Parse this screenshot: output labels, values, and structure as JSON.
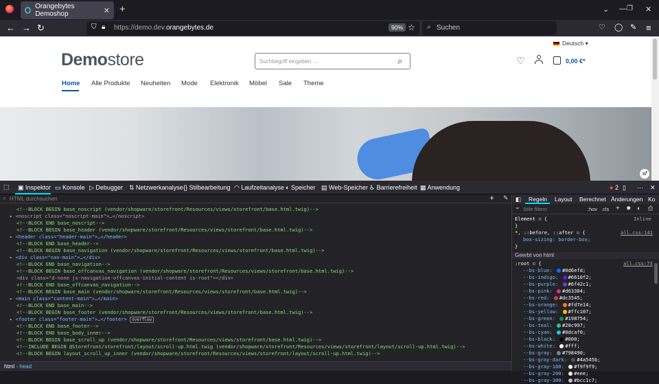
{
  "browser": {
    "tab_title": "Orangebytes Demoshop",
    "url_prefix": "https://demo.dev.",
    "url_domain": "orangebytes.de",
    "zoom": "90%",
    "search_placeholder": "Suchen"
  },
  "site": {
    "logo_bold": "Demo",
    "logo_light": "store",
    "search_placeholder": "Suchbegriff eingeben ...",
    "language": "Deutsch",
    "cart_total": "0,00 €*",
    "menu": [
      "Home",
      "Alle Produkte",
      "Neuheiten",
      "Mode",
      "Elektronik",
      "Möbel",
      "Sale",
      "Theme"
    ]
  },
  "devtools": {
    "tabs": [
      "Inspektor",
      "Konsole",
      "Debugger",
      "Netzwerkanalyse",
      "Stilbearbeitung",
      "Laufzeitanalyse",
      "Speicher",
      "Web-Speicher",
      "Barrierefreiheit",
      "Anwendung"
    ],
    "error_count": "2",
    "html_search_placeholder": "HTML durchsuchen",
    "breadcrumb": [
      "html",
      "head"
    ],
    "markup_lines": [
      "<!--BLOCK BEGIN base_noscript (vendor/shopware/storefront/Resources/views/storefront/base.html.twig)-->",
      "<noscript class=\"noscript-main\">…</noscript>",
      "<!--BLOCK END base_noscript-->",
      "<!--BLOCK BEGIN base_header (vendor/shopware/storefront/Resources/views/storefront/base.html.twig)-->",
      "<header class=\"header-main\">…</header>",
      "<!--BLOCK END base_header-->",
      "<!--BLOCK BEGIN base_navigation (vendor/shopware/storefront/Resources/views/storefront/base.html.twig)-->",
      "<div class=\"nav-main\">…</div>",
      "<!--BLOCK END base_navigation-->",
      "<!--BLOCK BEGIN base_offcanvas_navigation (vendor/shopware/storefront/Resources/views/storefront/base.html.twig)-->",
      "<div class=\"d-none js-navigation-offcanvas-initial-content is-root\"></div>",
      "<!--BLOCK END base_offcanvas_navigation-->",
      "<!--BLOCK BEGIN base_main (vendor/shopware/storefront/Resources/views/storefront/base.html.twig)-->",
      "<main class=\"content-main\">…</main>",
      "<!--BLOCK END base_main-->",
      "<!--BLOCK BEGIN base_footer (vendor/shopware/storefront/Resources/views/storefront/base.html.twig)-->",
      "<footer class=\"footer-main\">…</footer>",
      "<!--BLOCK END base_footer-->",
      "<!--BLOCK END base_body_inner-->",
      "<!--BLOCK BEGIN base_scroll_up (vendor/shopware/storefront/Resources/views/storefront/base.html.twig)-->",
      "<!--INCLUDE BEGIN @Storefront/storefront/layout/scroll-up.html.twig (vendor/shopware/storefront/Resources/views/storefront/layout/scroll-up.html.twig)-->",
      "<!--BLOCK BEGIN layout_scroll_up_inner (vendor/shopware/storefront/Resources/views/storefront/layout/scroll-up.html.twig)-->"
    ],
    "overflow_badge": "overflow",
    "rules_tabs": [
      "Regeln",
      "Layout",
      "Berechnet",
      "Änderungen",
      "Ko"
    ],
    "style_filter_placeholder": "Stile filtern",
    "pseudo_btns": [
      ":hov",
      ".cls"
    ],
    "element_rule": "Element",
    "inline_label": "Inline",
    "universal_selector": "*, ::before, ::after",
    "all_css_1": "all.css:141",
    "box_sizing": "box-sizing: border-box;",
    "inherited_label": "Geerbt von html",
    "root_selector": ":root",
    "all_css_2": "all.css:73",
    "vars": [
      {
        "name": "--bs-blue",
        "value": "#0d6efd",
        "color": "#0d6efd"
      },
      {
        "name": "--bs-indigo",
        "value": "#6610f2",
        "color": "#6610f2"
      },
      {
        "name": "--bs-purple",
        "value": "#6f42c1",
        "color": "#6f42c1"
      },
      {
        "name": "--bs-pink",
        "value": "#d63384",
        "color": "#d63384"
      },
      {
        "name": "--bs-red",
        "value": "#dc3545",
        "color": "#dc3545"
      },
      {
        "name": "--bs-orange",
        "value": "#fd7e14",
        "color": "#fd7e14"
      },
      {
        "name": "--bs-yellow",
        "value": "#ffc107",
        "color": "#ffc107"
      },
      {
        "name": "--bs-green",
        "value": "#198754",
        "color": "#198754"
      },
      {
        "name": "--bs-teal",
        "value": "#20c997",
        "color": "#20c997"
      },
      {
        "name": "--bs-cyan",
        "value": "#0dcaf0",
        "color": "#0dcaf0"
      },
      {
        "name": "--bs-black",
        "value": "#000",
        "color": "#000000"
      },
      {
        "name": "--bs-white",
        "value": "#fff",
        "color": "#ffffff"
      },
      {
        "name": "--bs-gray",
        "value": "#798490",
        "color": "#798490"
      },
      {
        "name": "--bs-gray-dark",
        "value": "#4a545b",
        "color": "#4a545b"
      },
      {
        "name": "--bs-gray-100",
        "value": "#f9f9f9",
        "color": "#f9f9f9"
      },
      {
        "name": "--bs-gray-200",
        "value": "#eee",
        "color": "#eeeeee"
      },
      {
        "name": "--bs-gray-300",
        "value": "#bcc1c7",
        "color": "#bcc1c7"
      }
    ]
  }
}
